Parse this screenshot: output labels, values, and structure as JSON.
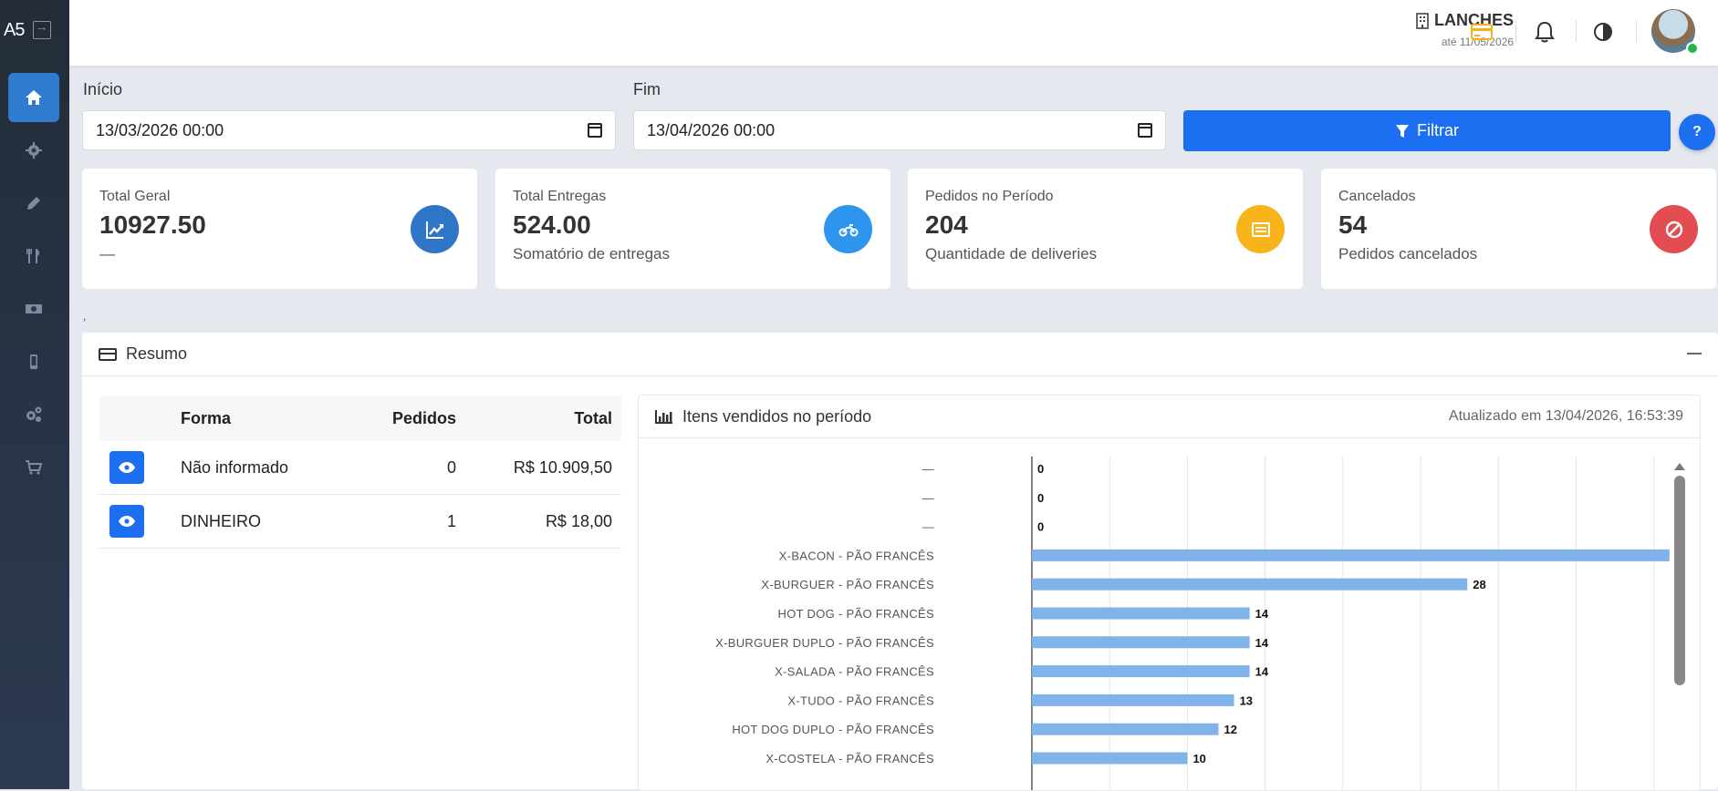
{
  "app": {
    "logo": "A5"
  },
  "sidebar": {
    "items": [
      {
        "icon": "home-icon",
        "active": true
      },
      {
        "icon": "gear-icon"
      },
      {
        "icon": "pencil-icon"
      },
      {
        "icon": "utensils-icon"
      },
      {
        "icon": "money-icon"
      },
      {
        "icon": "mobile-icon"
      },
      {
        "icon": "cogs-icon"
      },
      {
        "icon": "cart-icon"
      }
    ]
  },
  "header": {
    "store_name": "LANCHES",
    "store_sub": "até 11/05/2026"
  },
  "filters": {
    "start_label": "Início",
    "start_value": "13/03/2026 00:00",
    "end_label": "Fim",
    "end_value": "13/04/2026 00:00",
    "filter_button": "Filtrar",
    "help_button": "?"
  },
  "stats": [
    {
      "title": "Total Geral",
      "value": "10927.50",
      "sub": "—",
      "color": "#2f76c9",
      "icon": "chart-line-icon"
    },
    {
      "title": "Total Entregas",
      "value": "524.00",
      "sub": "Somatório de entregas",
      "color": "#2d95ee",
      "icon": "motorcycle-icon"
    },
    {
      "title": "Pedidos no Período",
      "value": "204",
      "sub": "Quantidade de deliveries",
      "color": "#f7b51b",
      "icon": "list-icon"
    },
    {
      "title": "Cancelados",
      "value": "54",
      "sub": "Pedidos cancelados",
      "color": "#e24d52",
      "icon": "ban-icon"
    }
  ],
  "stray_mark": ",",
  "resumo": {
    "title": "Resumo",
    "table": {
      "headers": [
        "Forma",
        "Pedidos",
        "Total"
      ],
      "rows": [
        {
          "forma": "Não informado",
          "pedidos": "0",
          "total": "R$ 10.909,50"
        },
        {
          "forma": "DINHEIRO",
          "pedidos": "1",
          "total": "R$ 18,00"
        }
      ]
    }
  },
  "chart_panel": {
    "title": "Itens vendidos no período",
    "updated": "Atualizado em 13/04/2026, 16:53:39"
  },
  "chart_data": {
    "type": "bar",
    "orientation": "horizontal",
    "categories": [
      "—",
      "—",
      "—",
      "X-BACON - PÃO FRANCÊS",
      "X-BURGUER - PÃO FRANCÊS",
      "HOT DOG - PÃO FRANCÊS",
      "X-BURGUER DUPLO - PÃO FRANCÊS",
      "X-SALADA - PÃO FRANCÊS",
      "X-TUDO - PÃO FRANCÊS",
      "HOT DOG DUPLO - PÃO FRANCÊS",
      "X-COSTELA - PÃO FRANCÊS"
    ],
    "values": [
      0,
      0,
      0,
      41,
      28,
      14,
      14,
      14,
      13,
      12,
      10
    ],
    "xlim": [
      0,
      45
    ],
    "grid": true,
    "bar_color": "#7fb3ea"
  }
}
